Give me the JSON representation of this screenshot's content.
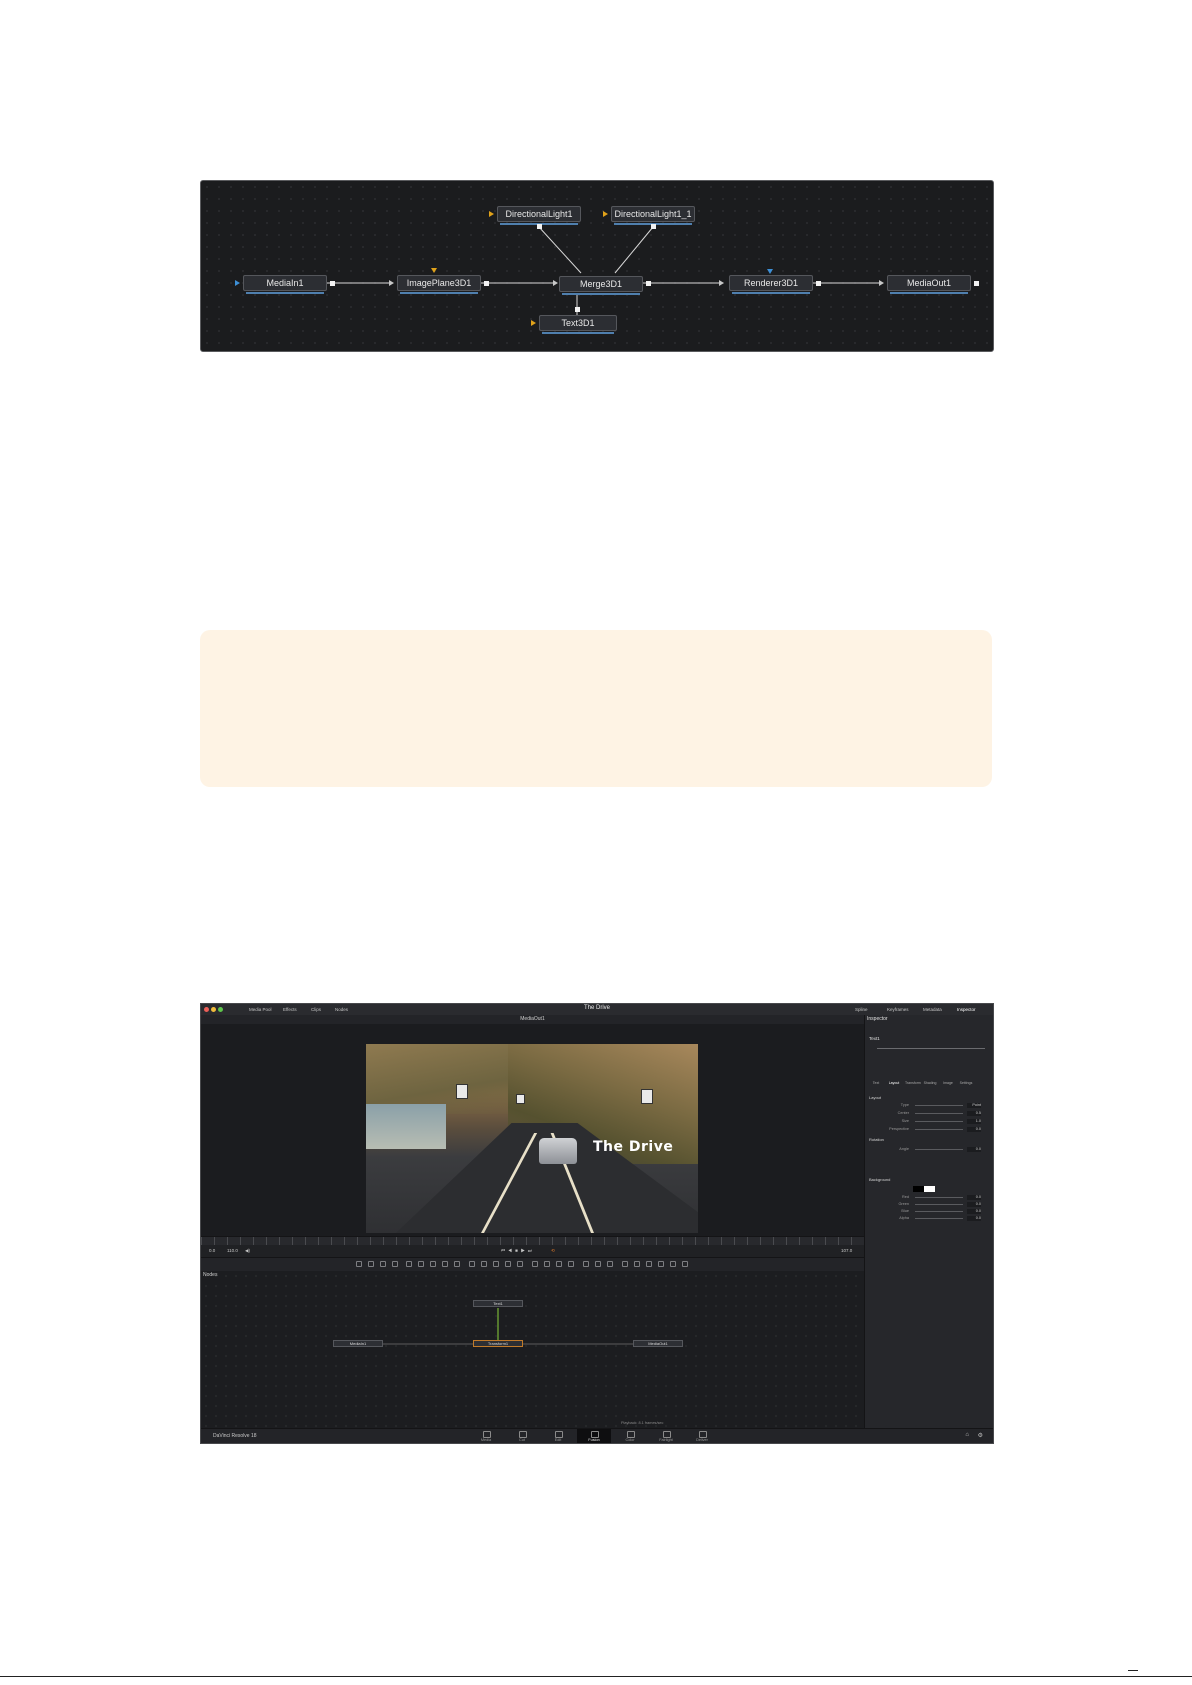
{
  "graph": {
    "nodes": {
      "directional_light_1": "DirectionalLight1",
      "directional_light_1_1": "DirectionalLight1_1",
      "media_in": "MediaIn1",
      "image_plane": "ImagePlane3D1",
      "merge": "Merge3D1",
      "renderer": "Renderer3D1",
      "media_out": "MediaOut1",
      "text3d": "Text3D1"
    }
  },
  "app": {
    "toolbar": {
      "media_pool": "Media Pool",
      "effects": "Effects",
      "clips": "Clips",
      "nodes": "Nodes",
      "spline": "Spline",
      "keyframes": "Keyframes",
      "metadata": "Metadata",
      "inspector": "Inspector"
    },
    "project_title": "The Drive",
    "viewer_title": "MediaOut1",
    "video_caption": "The Drive",
    "transport": {
      "start": "0.0",
      "end": "110.0",
      "current": "107.0"
    },
    "nodes_panel_label": "Nodes",
    "mini_nodes": {
      "text": "Text1",
      "media_in": "MediaIn1",
      "transform": "Transform1",
      "media_out": "MediaOut1"
    },
    "inspector": {
      "title": "Inspector",
      "node_name": "Text1",
      "tabs": [
        "Text",
        "Layout",
        "Transform",
        "Shading",
        "Image",
        "Settings"
      ],
      "sections": {
        "layout": "Layout",
        "rotation": "Rotation",
        "background": "Background"
      },
      "rows": [
        {
          "label": "Type",
          "value": "Point"
        },
        {
          "label": "Center",
          "value": "0.5"
        },
        {
          "label": "Size",
          "value": "1.0"
        },
        {
          "label": "Perspective",
          "value": "0.0"
        },
        {
          "label": "Angle",
          "value": "0.0"
        },
        {
          "label": "Red",
          "value": "0.0"
        },
        {
          "label": "Green",
          "value": "0.0"
        },
        {
          "label": "Blue",
          "value": "0.0"
        },
        {
          "label": "Alpha",
          "value": "0.0"
        }
      ]
    },
    "status_text": "Playback: 8.1 frames/sec",
    "brand": "DaVinci Resolve 18",
    "pages": [
      "Media",
      "Cut",
      "Edit",
      "Fusion",
      "Color",
      "Fairlight",
      "Deliver"
    ],
    "active_page": "Fusion"
  },
  "colors": {
    "accent_blue": "#4f7fae",
    "pin_orange": "#e0a21a",
    "pin_blue": "#3d8fd6",
    "note_bg": "#fef3e4"
  }
}
